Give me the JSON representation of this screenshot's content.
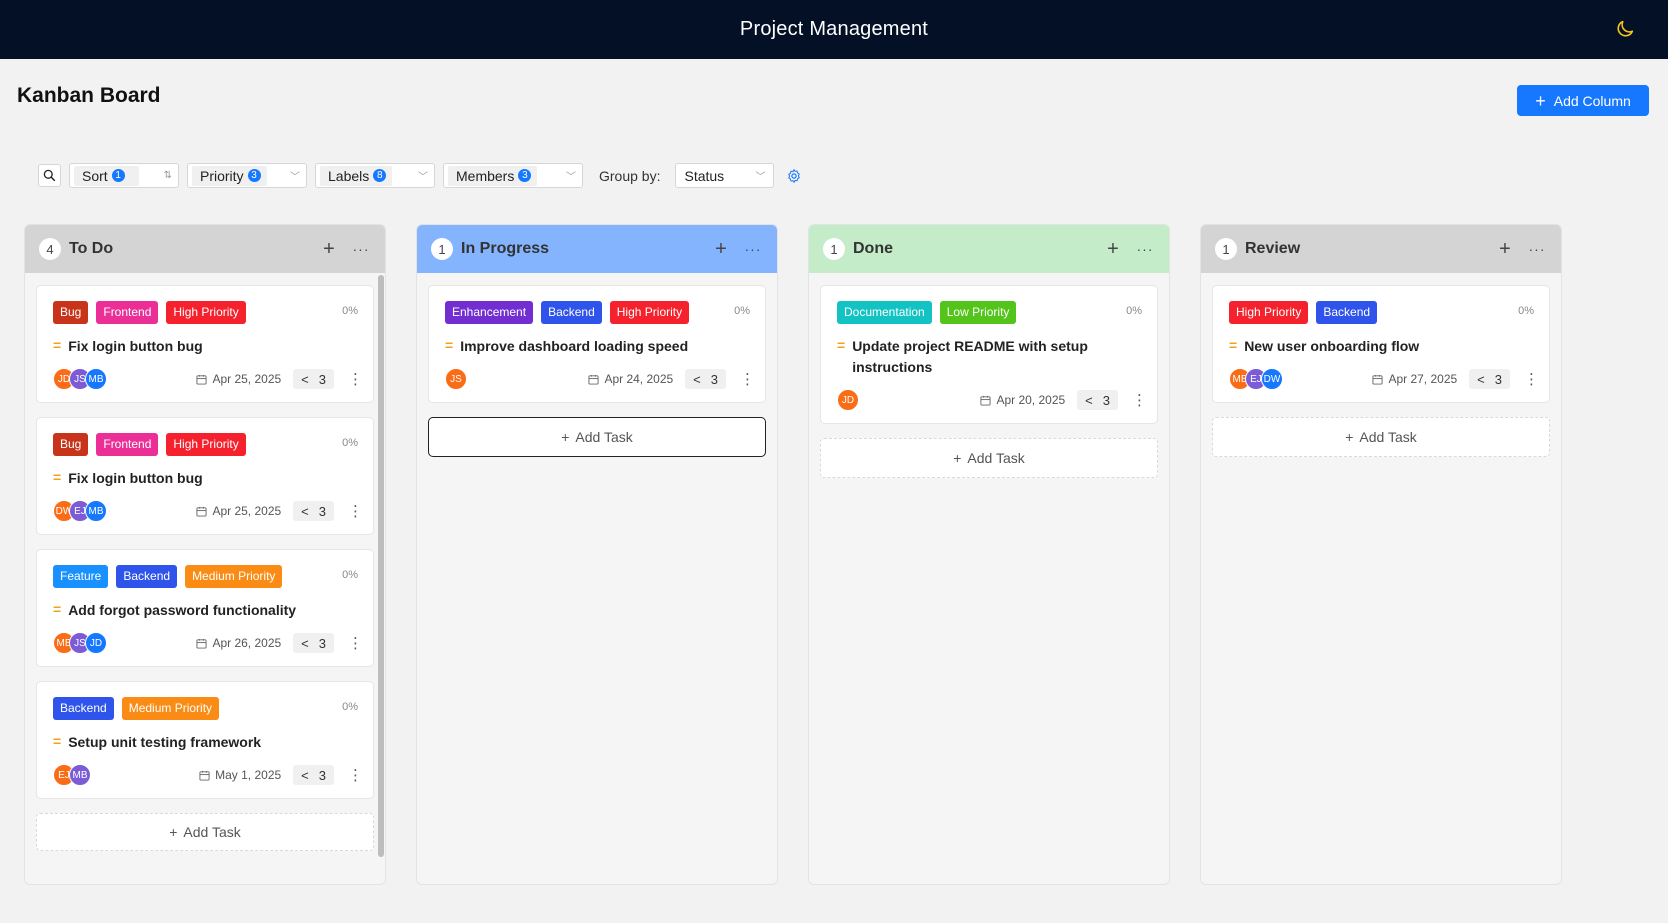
{
  "header": {
    "title": "Project Management",
    "theme_icon": "moon-icon"
  },
  "page": {
    "title": "Kanban Board",
    "add_column_label": "Add Column"
  },
  "toolbar": {
    "sort_label": "Sort",
    "sort_count": "1",
    "priority_label": "Priority",
    "priority_count": "3",
    "labels_label": "Labels",
    "labels_count": "8",
    "members_label": "Members",
    "members_count": "3",
    "group_by_label": "Group by:",
    "group_by_value": "Status"
  },
  "colors": {
    "Bug": "#c8341a",
    "Frontend": "#eb2f96",
    "High Priority": "#f5222d",
    "Feature": "#1890ff",
    "Backend": "#2f54eb",
    "Medium Priority": "#fa8c16",
    "Enhancement": "#722ed1",
    "Documentation": "#13c2c2",
    "Low Priority": "#52c41a",
    "avatar_orange": "#fa6c16",
    "avatar_purple": "#7b5cd6",
    "avatar_blue": "#1677ff",
    "todo_header": "#d4d4d4",
    "inprogress_header": "#85b4ff",
    "done_header": "#c5ecc8",
    "review_header": "#d4d4d4"
  },
  "add_task_label": "Add Task",
  "columns": [
    {
      "title": "To Do",
      "count": "4",
      "cards": [
        {
          "tags": [
            "Bug",
            "Frontend",
            "High Priority"
          ],
          "progress": "0%",
          "title": "Fix login button bug",
          "avatars": [
            [
              "JD",
              "orange"
            ],
            [
              "JS",
              "purple"
            ],
            [
              "MB",
              "blue"
            ]
          ],
          "date": "Apr 25, 2025",
          "subtasks": "3"
        },
        {
          "tags": [
            "Bug",
            "Frontend",
            "High Priority"
          ],
          "progress": "0%",
          "title": "Fix login button bug",
          "avatars": [
            [
              "DW",
              "orange"
            ],
            [
              "EJ",
              "purple"
            ],
            [
              "MB",
              "blue"
            ]
          ],
          "date": "Apr 25, 2025",
          "subtasks": "3"
        },
        {
          "tags": [
            "Feature",
            "Backend",
            "Medium Priority"
          ],
          "progress": "0%",
          "title": "Add forgot password functionality",
          "avatars": [
            [
              "MB",
              "orange"
            ],
            [
              "JS",
              "purple"
            ],
            [
              "JD",
              "blue"
            ]
          ],
          "date": "Apr 26, 2025",
          "subtasks": "3"
        },
        {
          "tags": [
            "Backend",
            "Medium Priority"
          ],
          "progress": "0%",
          "title": "Setup unit testing framework",
          "avatars": [
            [
              "EJ",
              "orange"
            ],
            [
              "MB",
              "purple"
            ]
          ],
          "date": "May 1, 2025",
          "subtasks": "3"
        }
      ]
    },
    {
      "title": "In Progress",
      "count": "1",
      "cards": [
        {
          "tags": [
            "Enhancement",
            "Backend",
            "High Priority"
          ],
          "progress": "0%",
          "title": "Improve dashboard loading speed",
          "avatars": [
            [
              "JS",
              "orange"
            ]
          ],
          "date": "Apr 24, 2025",
          "subtasks": "3"
        }
      ]
    },
    {
      "title": "Done",
      "count": "1",
      "cards": [
        {
          "tags": [
            "Documentation",
            "Low Priority"
          ],
          "progress": "0%",
          "title": "Update project README with setup instructions",
          "avatars": [
            [
              "JD",
              "orange"
            ]
          ],
          "date": "Apr 20, 2025",
          "subtasks": "3"
        }
      ]
    },
    {
      "title": "Review",
      "count": "1",
      "cards": [
        {
          "tags": [
            "High Priority",
            "Backend"
          ],
          "progress": "0%",
          "title": "New user onboarding flow",
          "avatars": [
            [
              "MB",
              "orange"
            ],
            [
              "EJ",
              "purple"
            ],
            [
              "DW",
              "blue"
            ]
          ],
          "date": "Apr 27, 2025",
          "subtasks": "3"
        }
      ]
    }
  ]
}
